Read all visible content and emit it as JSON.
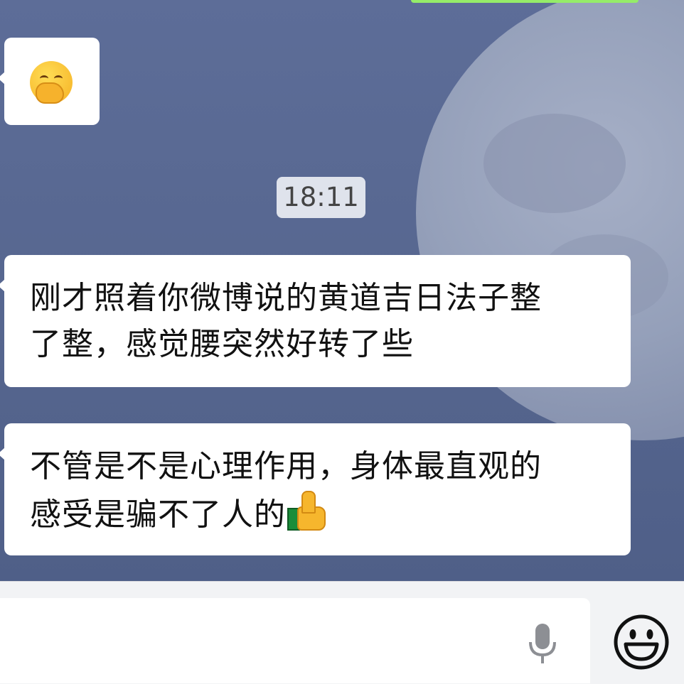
{
  "chat": {
    "timestamp": "18:11",
    "messages": [
      {
        "type": "emoji",
        "emoji": "grinning-face-with-hand-over-mouth"
      },
      {
        "type": "text",
        "text": "刚才照着你微博说的黄道吉日法子整\n了整，感觉腰突然好转了些"
      },
      {
        "type": "text",
        "text": "不管是不是心理作用，身体最直观的\n感受是骗不了人的",
        "trailing_emoji": "thumbs-up"
      }
    ]
  },
  "input_bar": {
    "icons": [
      "microphone-icon",
      "emoji-smiley-icon"
    ]
  },
  "colors": {
    "bubble": "#ffffff",
    "background": "#5a6a94",
    "timestamp_bg": "#dfe3ec",
    "input_bar": "#f2f3f5"
  }
}
